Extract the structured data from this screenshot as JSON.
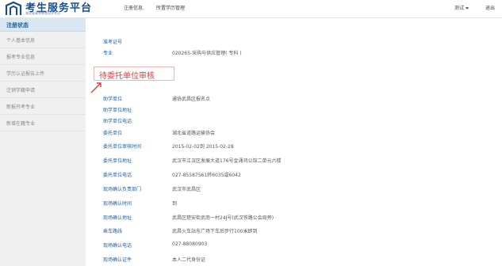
{
  "header": {
    "title": "考生服务平台",
    "subtitle": "湖北省高等教育自学考试",
    "nav": [
      "注册信息",
      "所置学历管理"
    ],
    "user": "测试",
    "logout": "退出"
  },
  "sidebar": {
    "heading": "注册状态",
    "items": [
      "个人基本信息",
      "报考专业信息",
      "学历认证报告上传",
      "注销学籍申请",
      "新报开考专业",
      "新增在籍专业"
    ]
  },
  "status_label": "待委托单位审核",
  "top_fields": [
    {
      "label": "准考证号",
      "value": ""
    },
    {
      "label": "专业",
      "value": "020265-采购与供应管理( 专科 )"
    }
  ],
  "fields": [
    {
      "label": "助学单位",
      "value": "通协武昌区报名点"
    },
    {
      "label": "助学单位地址",
      "value": ""
    },
    {
      "label": "助学单位电话",
      "value": ""
    },
    {
      "label": "委托单位",
      "value": "湖北省道路运输协会"
    },
    {
      "label": "委托单位审核时间",
      "value": "2015-02-02到 2015-02-28"
    },
    {
      "label": "委托单位地址",
      "value": "武汉市江汉区发展大道176号金涌鸿公馆二单元六楼"
    },
    {
      "label": "委托单位电话",
      "value": "027-85587561转6035或6042"
    },
    {
      "label": "现场确认负责部门",
      "value": "武汉市武昌区"
    },
    {
      "label": "现场确认时间",
      "value": "到"
    },
    {
      "label": "现场确认地址",
      "value": "武昌区楚安街武南一村24J号(武汉铁路公会局旁)"
    },
    {
      "label": "乘车路线",
      "value": "武昌火车站东广场下车后步行100米即到"
    },
    {
      "label": "现场确认电话",
      "value": "027-88080903"
    },
    {
      "label": "现场确认证件",
      "value": "本人二代身份证"
    }
  ]
}
